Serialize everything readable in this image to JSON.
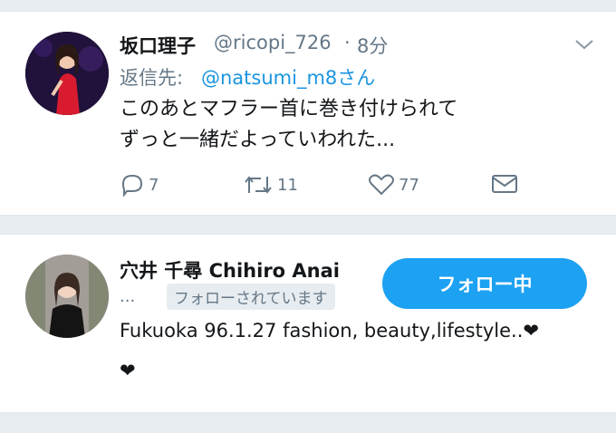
{
  "tweet": {
    "display_name": "坂口理子",
    "handle": "@ricopi_726",
    "separator": "·",
    "time": "8分",
    "reply_prefix": "返信先:",
    "reply_to": "@natsumi_m8さん",
    "text_line1": "このあとマフラー首に巻き付けられて",
    "text_line2": "ずっと一緒だよっていわれた...",
    "actions": {
      "reply_count": "7",
      "retweet_count": "11",
      "like_count": "77"
    }
  },
  "profile": {
    "display_name": "穴井 千尋 Chihiro Anai",
    "truncated_handle": "...",
    "follows_you": "フォローされています",
    "follow_button": "フォロー中",
    "bio_line1": "Fukuoka 96.1.27 fashion, beauty,lifestyle..❤",
    "bio_line2": "❤"
  },
  "colors": {
    "accent": "#1da1f2",
    "link": "#1b95e0",
    "muted": "#657786",
    "background": "#e6ecf0"
  },
  "icons": [
    "reply-icon",
    "retweet-icon",
    "like-icon",
    "dm-icon",
    "chevron-down-icon"
  ]
}
